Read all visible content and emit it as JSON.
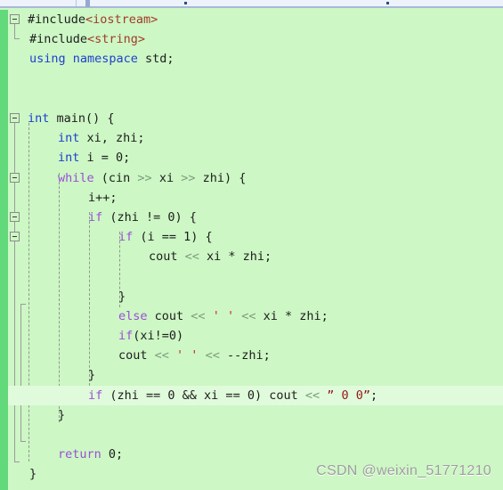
{
  "editor": {
    "language": "C++",
    "background_color": "#cdf7c5",
    "changebar_color": "#62d97a",
    "highlight_color": "#e0fbdb",
    "colors": {
      "keyword_purple": "#9a4fd6",
      "keyword_blue": "#1f3fd0",
      "include_path": "#a33a28",
      "string": "#8f1a18",
      "char_quote": "#d82020",
      "operator": "#7d9e7a",
      "plain": "#1d1d1d"
    },
    "lines": [
      {
        "n": 1,
        "indent": 0,
        "fold": "open",
        "text": "#include<iostream>"
      },
      {
        "n": 2,
        "indent": 0,
        "fold": "end",
        "text": "#include<string>"
      },
      {
        "n": 3,
        "indent": 0,
        "fold": "none",
        "text": "using namespace std;"
      },
      {
        "n": 4,
        "indent": 0,
        "fold": "none",
        "text": ""
      },
      {
        "n": 5,
        "indent": 0,
        "fold": "none",
        "text": ""
      },
      {
        "n": 6,
        "indent": 0,
        "fold": "open",
        "text": "int main() {"
      },
      {
        "n": 7,
        "indent": 1,
        "fold": "none",
        "text": "int xi, zhi;"
      },
      {
        "n": 8,
        "indent": 1,
        "fold": "none",
        "text": "int i = 0;"
      },
      {
        "n": 9,
        "indent": 1,
        "fold": "open",
        "text": "while (cin >> xi >> zhi) {"
      },
      {
        "n": 10,
        "indent": 2,
        "fold": "none",
        "text": "i++;"
      },
      {
        "n": 11,
        "indent": 2,
        "fold": "open",
        "text": "if (zhi != 0) {"
      },
      {
        "n": 12,
        "indent": 3,
        "fold": "open",
        "text": "if (i == 1) {"
      },
      {
        "n": 13,
        "indent": 4,
        "fold": "none",
        "text": "cout << xi * zhi;"
      },
      {
        "n": 14,
        "indent": 4,
        "fold": "none",
        "text": ""
      },
      {
        "n": 15,
        "indent": 3,
        "fold": "none",
        "text": "}"
      },
      {
        "n": 16,
        "indent": 3,
        "fold": "none",
        "text": "else cout << ' ' << xi * zhi;"
      },
      {
        "n": 17,
        "indent": 3,
        "fold": "none",
        "text": "if(xi!=0)"
      },
      {
        "n": 18,
        "indent": 3,
        "fold": "none",
        "text": "cout << ' ' << --zhi;"
      },
      {
        "n": 19,
        "indent": 2,
        "fold": "none",
        "text": "}"
      },
      {
        "n": 20,
        "indent": 2,
        "fold": "none",
        "text": "if (zhi == 0 && xi == 0) cout << \" 0 0\";",
        "highlighted": true
      },
      {
        "n": 21,
        "indent": 1,
        "fold": "none",
        "text": "}"
      },
      {
        "n": 22,
        "indent": 1,
        "fold": "none",
        "text": ""
      },
      {
        "n": 23,
        "indent": 1,
        "fold": "none",
        "text": "return 0;"
      },
      {
        "n": 24,
        "indent": 0,
        "fold": "none",
        "text": "}"
      }
    ]
  },
  "watermark": {
    "text": "CSDN @weixin_51771210"
  }
}
